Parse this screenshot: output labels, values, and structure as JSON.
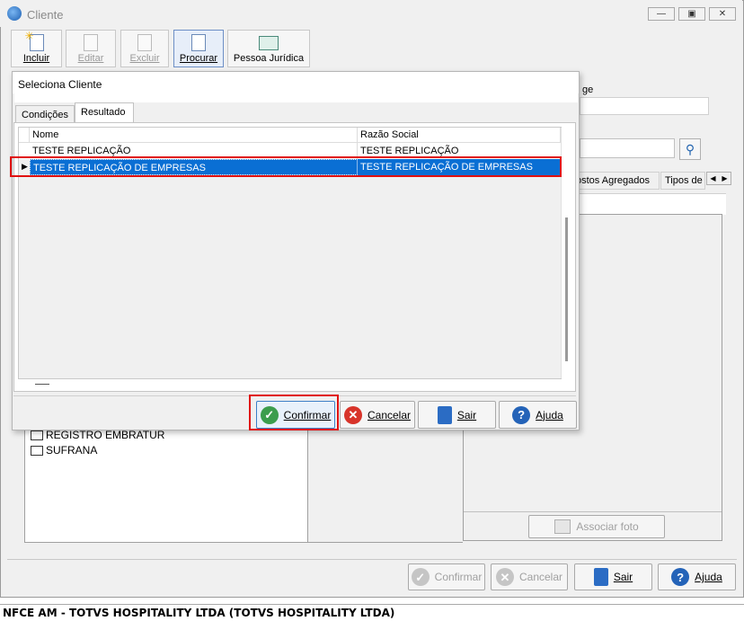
{
  "window": {
    "title": "Cliente"
  },
  "toolbar": {
    "incluir": "Incluir",
    "editar": "Editar",
    "excluir": "Excluir",
    "procurar": "Procurar",
    "pessoa_juridica": "Pessoa Jurídica"
  },
  "background": {
    "partial_label": "ge",
    "tabs_text": "ostos Agregados",
    "tabs_text2": "Tipos de",
    "list_items": [
      "REGISTRO EMBRATUR",
      "SUFRANA"
    ],
    "associar_foto": "Associar foto"
  },
  "dialog": {
    "title": "Seleciona Cliente",
    "tabs": [
      "Condições",
      "Resultado"
    ],
    "columns": [
      "Nome",
      "Razão Social"
    ],
    "rows": [
      {
        "nome": "TESTE REPLICAÇÃO",
        "razao": "TESTE REPLICAÇÃO"
      },
      {
        "nome": "TESTE REPLICAÇÃO DE EMPRESAS",
        "razao": "TESTE REPLICAÇÃO DE EMPRESAS"
      }
    ],
    "buttons": {
      "confirmar": "Confirmar",
      "cancelar": "Cancelar",
      "sair": "Sair",
      "ajuda": "Ajuda"
    }
  },
  "footer_buttons": {
    "confirmar": "Confirmar",
    "cancelar": "Cancelar",
    "sair": "Sair",
    "ajuda": "Ajuda"
  },
  "status_bar": "NFCE AM - TOTVS HOSPITALITY LTDA (TOTVS HOSPITALITY LTDA)"
}
